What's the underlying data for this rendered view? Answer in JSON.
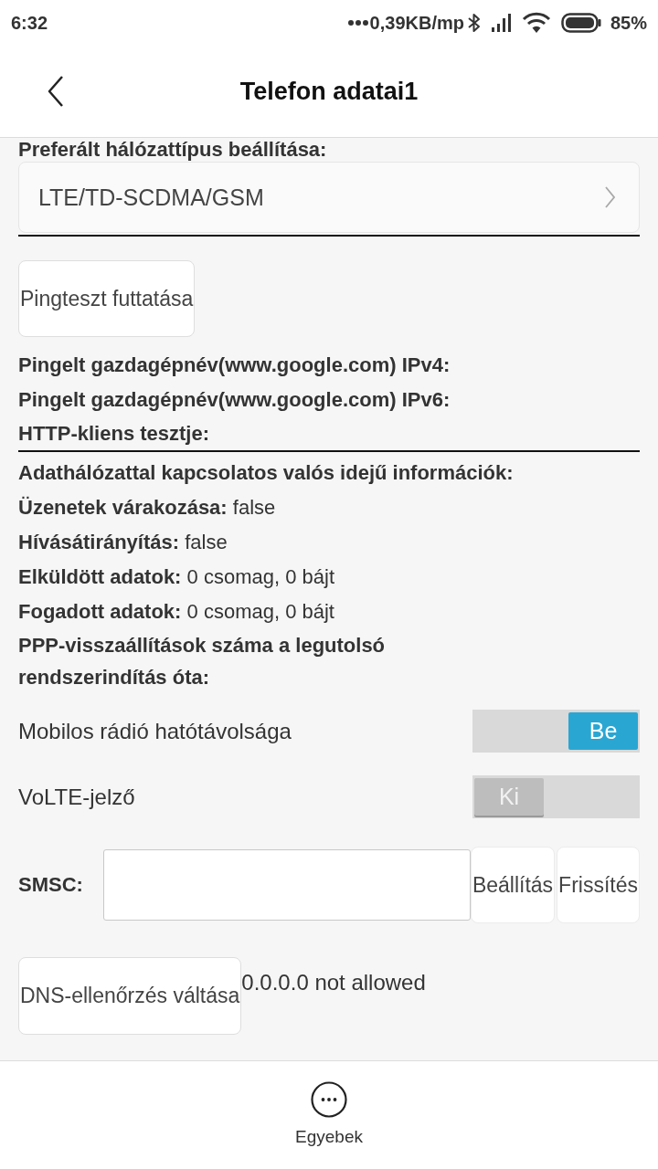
{
  "status_bar": {
    "time": "6:32",
    "network_speed": "0,39KB/mp",
    "battery": "85%"
  },
  "header": {
    "title": "Telefon adatai1"
  },
  "network_type": {
    "label": "Preferált hálózattípus beállítása:",
    "value": "LTE/TD-SCDMA/GSM"
  },
  "ping_button": "Pingteszt futtatása",
  "ping_results": [
    "Pingelt gazdagépnév(www.google.com) IPv4:",
    "Pingelt gazdagépnév(www.google.com) IPv6:",
    "HTTP-kliens tesztje:"
  ],
  "realtime": {
    "heading": "Adathálózattal kapcsolatos valós idejű információk:",
    "items": [
      {
        "label": "Üzenetek várakozása:",
        "value": "false"
      },
      {
        "label": "Hívásátirányítás:",
        "value": "false"
      },
      {
        "label": "Elküldött adatok:",
        "value": "0 csomag, 0 bájt"
      },
      {
        "label": "Fogadott adatok:",
        "value": "0 csomag, 0 bájt"
      },
      {
        "label": "PPP-visszaállítások száma a legutolsó rendszerindítás óta:"
      }
    ]
  },
  "toggles": [
    {
      "label": "Mobilos rádió hatótávolsága",
      "on": true,
      "state_label": "Be"
    },
    {
      "label": "VoLTE-jelző",
      "on": false,
      "state_label": "Ki"
    }
  ],
  "smsc": {
    "label": "SMSC:",
    "buttons": [
      "Beállítás",
      "Frissítés"
    ]
  },
  "dns": {
    "button": "DNS-ellenőrzés váltása",
    "status": "0.0.0.0 not allowed"
  },
  "bottom_bar": {
    "label": "Egyebek"
  }
}
